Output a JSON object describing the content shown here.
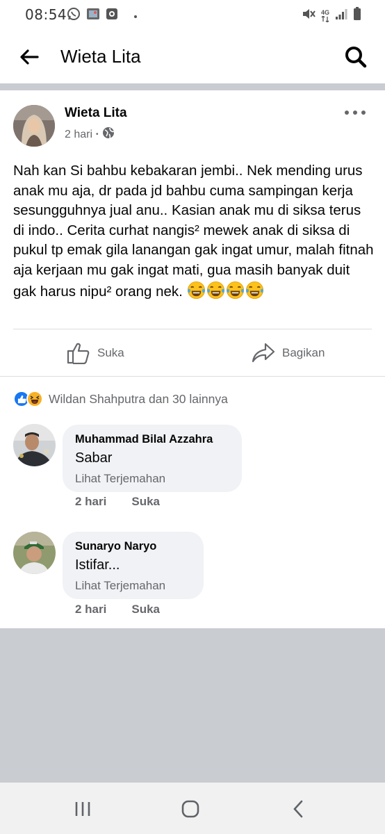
{
  "status_bar": {
    "time": "08:54",
    "left_icons": [
      "whatsapp-icon",
      "gallery-icon",
      "screen-record-icon",
      "dot-icon"
    ],
    "right_icons": [
      "mute-icon",
      "network-4g-icon",
      "signal-icon",
      "battery-icon"
    ],
    "network_label": "4G"
  },
  "app_bar": {
    "title": "Wieta Lita"
  },
  "post": {
    "author": "Wieta Lita",
    "time": "2 hari",
    "meta_separator": "•",
    "privacy_icon": "globe-icon",
    "text": "Nah kan Si bahbu kebakaran jembi..  Nek mending urus anak mu aja,  dr pada jd bahbu cuma sampingan kerja sesungguhnya jual anu..  Kasian anak mu di siksa terus di indo..  Cerita curhat nangis² mewek anak di siksa di pukul tp emak gila lanangan gak ingat umur, malah fitnah aja kerjaan mu gak ingat mati, gua masih banyak duit gak harus nipu² orang nek.",
    "emojis": [
      "😂",
      "😂",
      "😂",
      "😂"
    ],
    "actions": {
      "like_label": "Suka",
      "share_label": "Bagikan"
    },
    "reactions": {
      "icons": [
        "like-reaction-icon",
        "haha-reaction-icon"
      ],
      "summary": "Wildan Shahputra dan 30 lainnya"
    }
  },
  "comments": [
    {
      "author": "Muhammad Bilal Azzahra",
      "text": "Sabar",
      "translate": "Lihat Terjemahan",
      "time": "2 hari",
      "like_label": "Suka"
    },
    {
      "author": "Sunaryo Naryo",
      "text": "Istifar...",
      "translate": "Lihat Terjemahan",
      "time": "2 hari",
      "like_label": "Suka"
    }
  ],
  "nav_bar": {
    "buttons": [
      "recent-apps-icon",
      "home-icon",
      "back-icon"
    ]
  },
  "colors": {
    "text_primary": "#050505",
    "text_secondary": "#65676b",
    "bubble_bg": "#f0f2f5",
    "separator": "#c9ccd1",
    "like_blue": "#1877f2",
    "haha_yellow": "#f7b125"
  }
}
